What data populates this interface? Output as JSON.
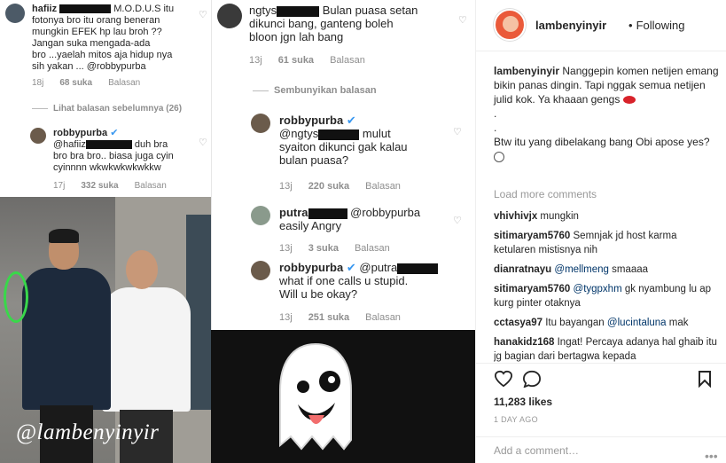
{
  "post": {
    "media": {
      "panel1": {
        "c1": {
          "user": "hafiiz",
          "text_after_redact": "M.O.D.U.S itu",
          "text_lines": [
            "fotonya bro itu orang beneran",
            "mungkin EFEK hp lau broh ??",
            "Jangan suka mengada-ada",
            "bro ...yaelah mitos aja hidup nya",
            "sih yakan ... @robbypurba"
          ],
          "time": "18j",
          "likes": "68 suka",
          "reply": "Balasan"
        },
        "view_prev": "Lihat balasan sebelumnya (26)",
        "c2": {
          "user": "robbypurba",
          "mention": "@hafiiz",
          "text_after_redact": "duh bra",
          "text_lines": [
            "bro bra bro.. biasa juga cyin",
            "cyinnnn wkwkwkwkwkkw"
          ],
          "time": "17j",
          "likes": "332 suka",
          "reply": "Balasan"
        }
      },
      "panel2": {
        "c1": {
          "user": "ngtys",
          "text_first": "Bulan puasa setan",
          "text_lines": [
            "dikunci bang, ganteng boleh",
            "bloon jgn lah bang"
          ],
          "time": "13j",
          "likes": "61 suka",
          "reply": "Balasan"
        },
        "hide_replies": "Sembunyikan balasan",
        "c2": {
          "user": "robbypurba",
          "mention": "@ngtys",
          "text_after_redact": "mulut",
          "text_lines": [
            "syaiton dikunci gak kalau",
            "bulan puasa?"
          ],
          "time": "13j",
          "likes": "220 suka",
          "reply": "Balasan"
        },
        "c3": {
          "user": "putra",
          "text_after_redact": "@robbypurba",
          "text_lines": [
            "easily Angry"
          ],
          "time": "13j",
          "likes": "3 suka",
          "reply": "Balasan"
        },
        "c4": {
          "user": "robbypurba",
          "mention": "@putra",
          "text_lines": [
            "what if one calls u stupid.",
            "Will u be okay?"
          ],
          "time": "13j",
          "likes": "251 suka",
          "reply": "Balasan"
        }
      },
      "watermark": "@lambenyinyir"
    },
    "header": {
      "username": "lambenyinyir",
      "separator": "•",
      "follow_state": "Following"
    },
    "caption": {
      "username": "lambenyinyir",
      "text": "Nanggepin komen netijen emang bikin panas dingin. Tapi nggak semua netijen julid kok. Ya khaaan gengs",
      "dot1": ".",
      "dot2": ".",
      "text2": "Btw itu yang dibelakang bang Obi apose yes?"
    },
    "load_more": "Load more comments",
    "comments": [
      {
        "user": "vhivhivjx",
        "text": "mungkin"
      },
      {
        "user": "sitimaryam5760",
        "text": "Semnjak jd host karma ketularen mistisnya nih"
      },
      {
        "user": "dianratnayu",
        "mention": "@mellmeng",
        "text": "smaaaa"
      },
      {
        "user": "sitimaryam5760",
        "mention": "@tygpxhm",
        "text": "gk nyambung lu ap kurg pinter otaknya"
      },
      {
        "user": "cctasya97",
        "text_pre": "Itu bayangan",
        "mention": "@lucintaluna",
        "text": "mak"
      },
      {
        "user": "hanakidz168",
        "text": "Ingat! Percaya adanya hal ghaib itu jg bagian dari bertagwa kepada"
      }
    ],
    "likes": "11,283 likes",
    "time_ago": "1 DAY AGO",
    "add_comment_placeholder": "Add a comment…",
    "more_icon": "•••",
    "colors": {
      "accent": "#3897f0",
      "mention": "#003569",
      "muted": "#8e8e8e"
    }
  }
}
